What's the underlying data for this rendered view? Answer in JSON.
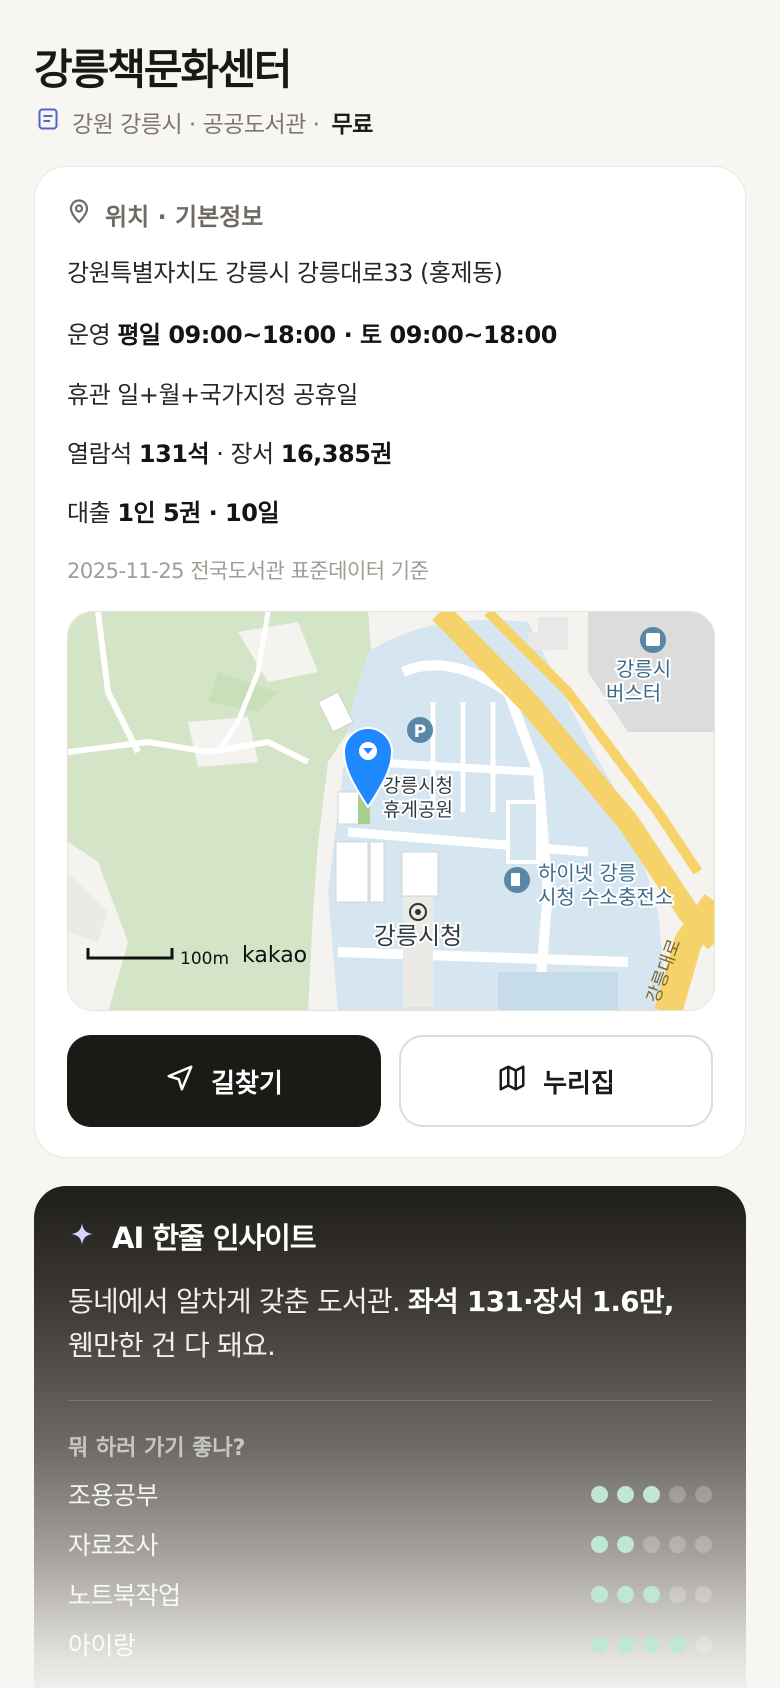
{
  "library": {
    "name": "강릉책문화센터",
    "region": "강원 강릉시",
    "type": "공공도서관",
    "fee": "무료"
  },
  "info": {
    "section_title": "위치 · 기본정보",
    "address": "강원특별자치도 강릉시 강릉대로33 (홍제동)",
    "hours_label": "운영",
    "hours_value": "평일 09:00~18:00 · 토 09:00~18:00",
    "closed": "휴관 일+월+국가지정 공휴일",
    "seats_label": "열람석",
    "seats_value": "131석",
    "books_label": "장서",
    "books_value": "16,385권",
    "loan_label": "대출",
    "loan_value": "1인 5권 · 10일",
    "source_note": "2025-11-25 전국도서관 표준데이터 기준"
  },
  "map": {
    "poi_park_line1": "강릉시청",
    "poi_park_line2": "휴게공원",
    "poi_cityhall": "강릉시청",
    "poi_h2_line1": "하이넷 강릉",
    "poi_h2_line2": "시청 수소충전소",
    "poi_bus_line1": "강릉시",
    "poi_bus_line2": "버스터",
    "road_label": "강릉대로",
    "scale_label": "100m",
    "provider": "kakao",
    "parking_symbol": "P"
  },
  "buttons": {
    "directions": "길찾기",
    "nurijip": "누리집"
  },
  "ai": {
    "title": "AI 한줄 인사이트",
    "text_plain": "동네에서 알차게 갖춘 도서관.",
    "text_bold": "좌석 131·장서 1.6만,",
    "text_tail": "웬만한 건 다 돼요.",
    "question": "뭐 하러 가기 좋나?",
    "activities": [
      {
        "label": "조용공부",
        "level": 3,
        "max": 5
      },
      {
        "label": "자료조사",
        "level": 2,
        "max": 5
      },
      {
        "label": "노트북작업",
        "level": 3,
        "max": 5
      },
      {
        "label": "아이랑",
        "level": 4,
        "max": 5
      }
    ]
  },
  "colors": {
    "accent_dark": "#1c1a17",
    "pin_blue": "#1e88ff",
    "dot_on": "#bfe6d6"
  }
}
